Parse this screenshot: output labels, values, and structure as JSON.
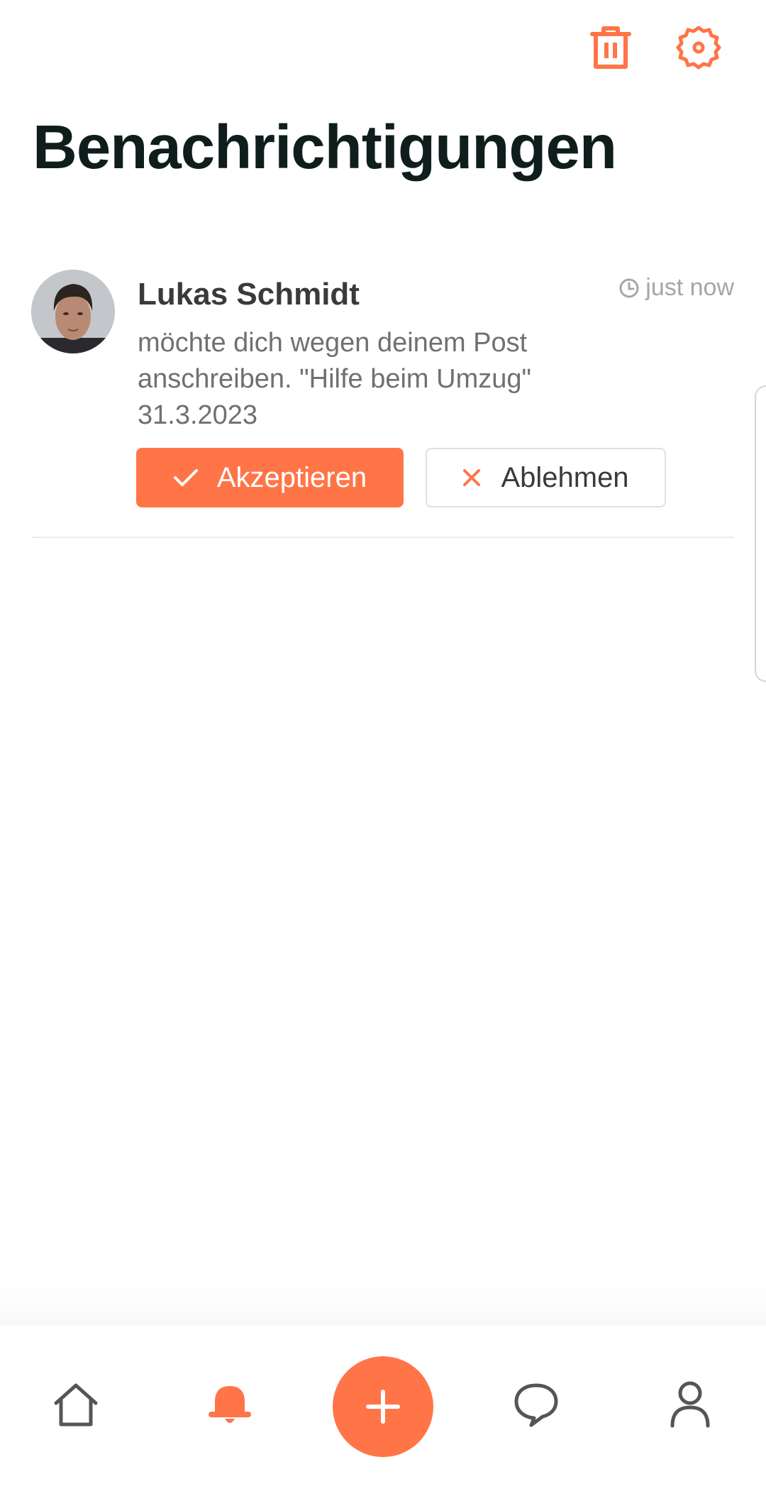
{
  "header": {
    "title": "Benachrichtigungen",
    "delete_icon": "trash-icon",
    "settings_icon": "gear-icon"
  },
  "notifications": [
    {
      "name": "Lukas Schmidt",
      "time": "just now",
      "body_lines": [
        "möchte dich wegen deinem Post",
        "anschreiben. \"Hilfe beim Umzug\"",
        "31.3.2023"
      ],
      "accept_label": "Akzeptieren",
      "decline_label": "Ablehmen"
    }
  ],
  "bottom_nav": {
    "items": [
      "home-icon",
      "bell-icon",
      "plus-icon",
      "chat-icon",
      "user-icon"
    ],
    "active": "bell-icon"
  },
  "colors": {
    "accent": "#ff7547",
    "title": "#0f1e1c",
    "text": "#3a3a3a",
    "muted": "#707070",
    "nav_icon": "#555555"
  }
}
